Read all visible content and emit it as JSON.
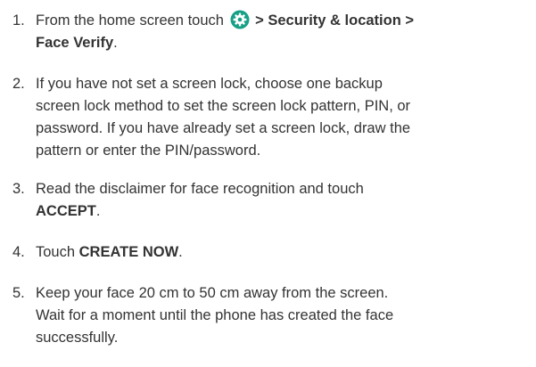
{
  "steps": [
    {
      "number": "1.",
      "line1_prefix": "From the home screen touch",
      "icon": "settings-gear-icon",
      "icon_color": "#16a085",
      "line1_bold": " > Security & location >",
      "line2_bold": "Face Verify",
      "line2_suffix": "."
    },
    {
      "number": "2.",
      "lines": [
        "If you have not set a screen lock, choose one backup",
        "screen lock method to set the screen lock pattern, PIN, or",
        "password. If you have already set a screen lock, draw the",
        "pattern or enter the PIN/password."
      ]
    },
    {
      "number": "3.",
      "line1": "Read the disclaimer for face recognition and touch",
      "line2_bold": "ACCEPT",
      "line2_suffix": "."
    },
    {
      "number": "4.",
      "prefix": "Touch ",
      "bold": "CREATE NOW",
      "suffix": "."
    },
    {
      "number": "5.",
      "lines": [
        "Keep your face 20 cm to 50 cm away from the screen.",
        "Wait for a moment until the phone has created the face",
        "successfully."
      ]
    }
  ]
}
